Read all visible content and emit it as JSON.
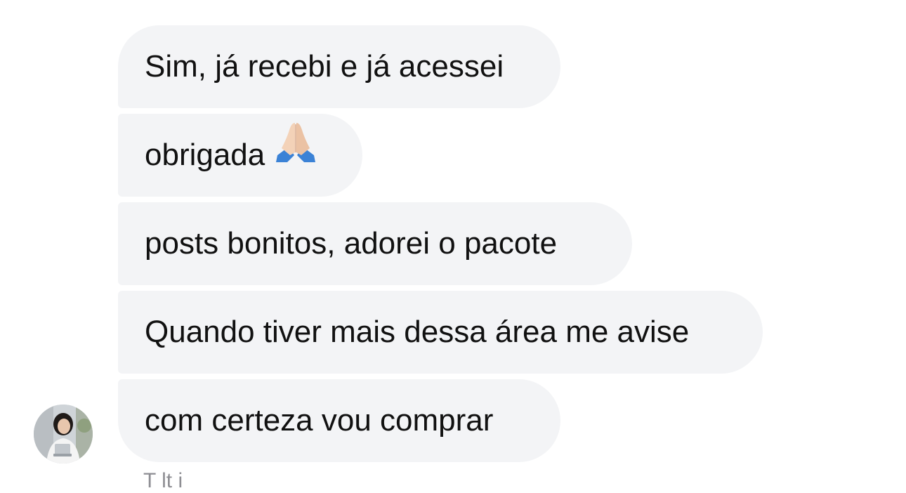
{
  "messages": [
    {
      "text": "Sim, já recebi e já acessei"
    },
    {
      "text": "obrigada",
      "emoji": "folded-hands-icon"
    },
    {
      "text": "posts bonitos, adorei o pacote"
    },
    {
      "text": "Quando tiver mais dessa área me avise"
    },
    {
      "text": "com certeza vou comprar"
    }
  ],
  "footer": {
    "text": "T         lt          i"
  },
  "colors": {
    "bubble_bg": "#f3f4f6",
    "text": "#111111",
    "meta_text": "#8e8e93"
  }
}
